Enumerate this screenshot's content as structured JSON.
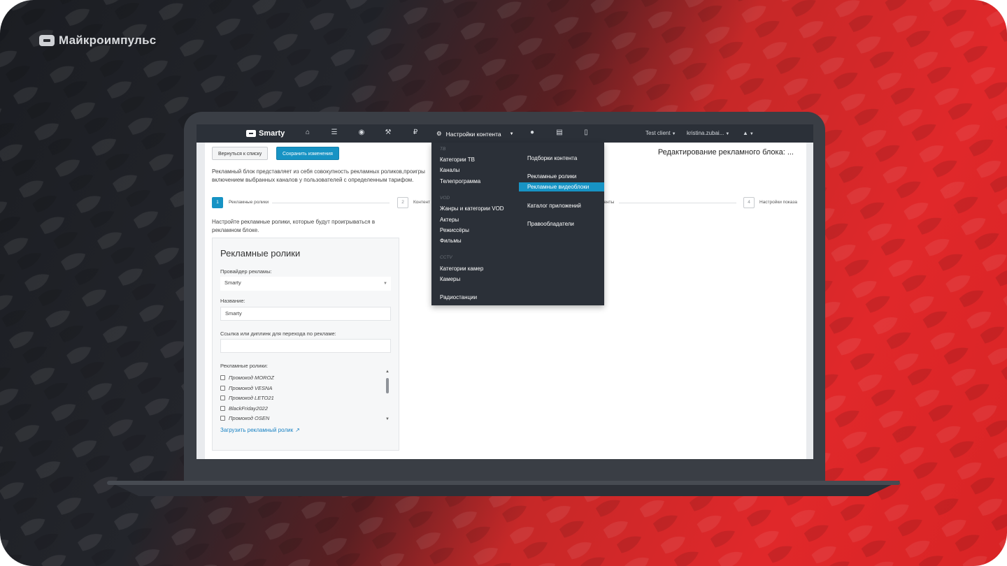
{
  "brand": {
    "name": "Майкроимпульс"
  },
  "navbar": {
    "logo": "Smarty",
    "icons": [
      "home-icon",
      "server-icon",
      "eye-icon",
      "wrench-icon",
      "ruble-icon",
      "user-icon",
      "document-icon",
      "chart-icon"
    ],
    "active_menu": "Настройки контента",
    "client": "Test client",
    "user": "kristina.zubai...",
    "bell": "bell-icon"
  },
  "page": {
    "back_button": "Вернуться к списку",
    "save_button": "Сохранить изменения",
    "title": "Редактирование рекламного блока: ...",
    "intro_line1": "Рекламный блок представляет из себя совокупность рекламных роликов,проигры",
    "intro_line2": "включением выбранных каналов у пользователей с определенным тарифом.",
    "steps": [
      {
        "num": "1",
        "label": "Рекламные ролики"
      },
      {
        "num": "2",
        "label": "Контент"
      },
      {
        "num": "",
        "label": "менты"
      },
      {
        "num": "4",
        "label": "Настройки показа"
      }
    ],
    "hint_line1": "Настройте рекламные ролики, которые будут проигрываться в",
    "hint_line2": "рекламном блоке."
  },
  "card": {
    "title": "Рекламные ролики",
    "provider_label": "Провайдер рекламы:",
    "provider_value": "Smarty",
    "name_label": "Название:",
    "name_value": "Smarty",
    "link_label": "Ссылка или диплинк для перехода по рекламе:",
    "link_value": "",
    "videos_label": "Рекламные ролики:",
    "videos": [
      "Промокод MOROZ",
      "Промокод VESNA",
      "Промокод LETO21",
      "BlackFriday2022",
      "Промокод OSEN"
    ],
    "upload_link": "Загрузить рекламный ролик"
  },
  "dropdown": {
    "cat_tv": "ТВ",
    "tv_items": [
      "Категории ТВ",
      "Каналы",
      "Телепрограмма"
    ],
    "cat_vod": "VOD",
    "vod_items": [
      "Жанры и категории VOD",
      "Актеры",
      "Режиссёры",
      "Фильмы"
    ],
    "cat_cctv": "CCTV",
    "cctv_items": [
      "Категории камер",
      "Камеры"
    ],
    "radio": "Радиостанции",
    "col2": [
      "Подборки контента",
      "Рекламные ролики",
      "Рекламные видеоблоки",
      "Каталог приложений",
      "Правообладатели"
    ],
    "highlighted": "Рекламные видеоблоки"
  },
  "colors": {
    "accent": "#1793c4",
    "navbar": "#2b3038",
    "bg_red": "#e0282a",
    "bg_dark": "#1b1d22"
  }
}
